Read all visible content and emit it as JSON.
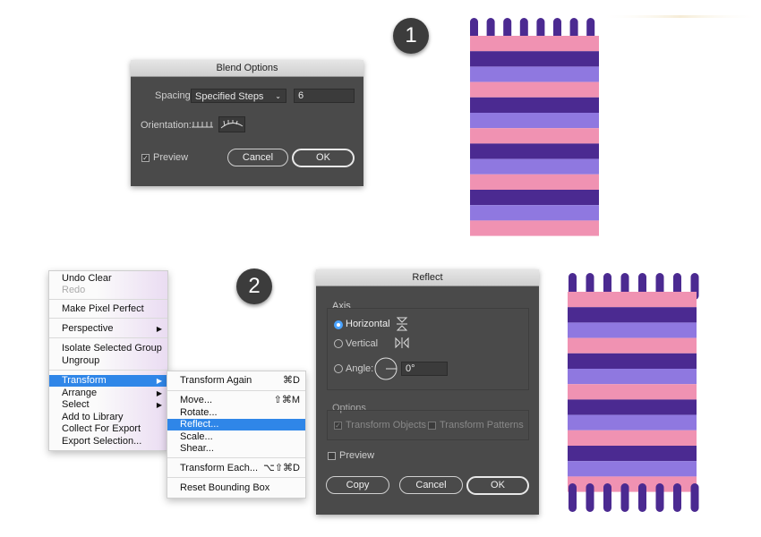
{
  "badges": {
    "step1": "1",
    "step2": "2"
  },
  "blend_options": {
    "title": "Blend Options",
    "spacing_label": "Spacing:",
    "spacing_value": "Specified Steps",
    "steps_value": "6",
    "orientation_label": "Orientation:",
    "preview_label": "Preview",
    "preview_checked": true,
    "cancel_label": "Cancel",
    "ok_label": "OK"
  },
  "context_menu": {
    "items": [
      {
        "label": "Undo Clear"
      },
      {
        "label": "Redo",
        "disabled": true
      },
      {
        "label": "Make Pixel Perfect"
      },
      {
        "label": "Perspective",
        "submenu": true
      },
      {
        "label": "Isolate Selected Group"
      },
      {
        "label": "Ungroup"
      },
      {
        "label": "Transform",
        "submenu": true,
        "highlighted": true
      },
      {
        "label": "Arrange",
        "submenu": true
      },
      {
        "label": "Select",
        "submenu": true
      },
      {
        "label": "Add to Library"
      },
      {
        "label": "Collect For Export"
      },
      {
        "label": "Export Selection..."
      }
    ]
  },
  "transform_submenu": {
    "items": [
      {
        "label": "Transform Again",
        "shortcut": "⌘D"
      },
      {
        "label": "Move...",
        "shortcut": "⇧⌘M"
      },
      {
        "label": "Rotate...",
        "shortcut": ""
      },
      {
        "label": "Reflect...",
        "shortcut": "",
        "highlighted": true
      },
      {
        "label": "Scale...",
        "shortcut": ""
      },
      {
        "label": "Shear...",
        "shortcut": ""
      },
      {
        "label": "Transform Each...",
        "shortcut": "⌥⇧⌘D"
      },
      {
        "label": "Reset Bounding Box",
        "shortcut": ""
      }
    ]
  },
  "reflect": {
    "title": "Reflect",
    "axis_label": "Axis",
    "horizontal_label": "Horizontal",
    "vertical_label": "Vertical",
    "angle_label": "Angle:",
    "angle_value": "0°",
    "selected_axis": "Horizontal",
    "options_label": "Options",
    "transform_objects_label": "Transform Objects",
    "transform_patterns_label": "Transform Patterns",
    "preview_label": "Preview",
    "copy_label": "Copy",
    "cancel_label": "Cancel",
    "ok_label": "OK"
  },
  "colors": {
    "pink": "#f092b2",
    "dark_purple": "#4b2a91",
    "light_purple": "#8f78e0",
    "dialog_bg": "#4a4a4a",
    "menu_highlight": "#2f86e8"
  }
}
